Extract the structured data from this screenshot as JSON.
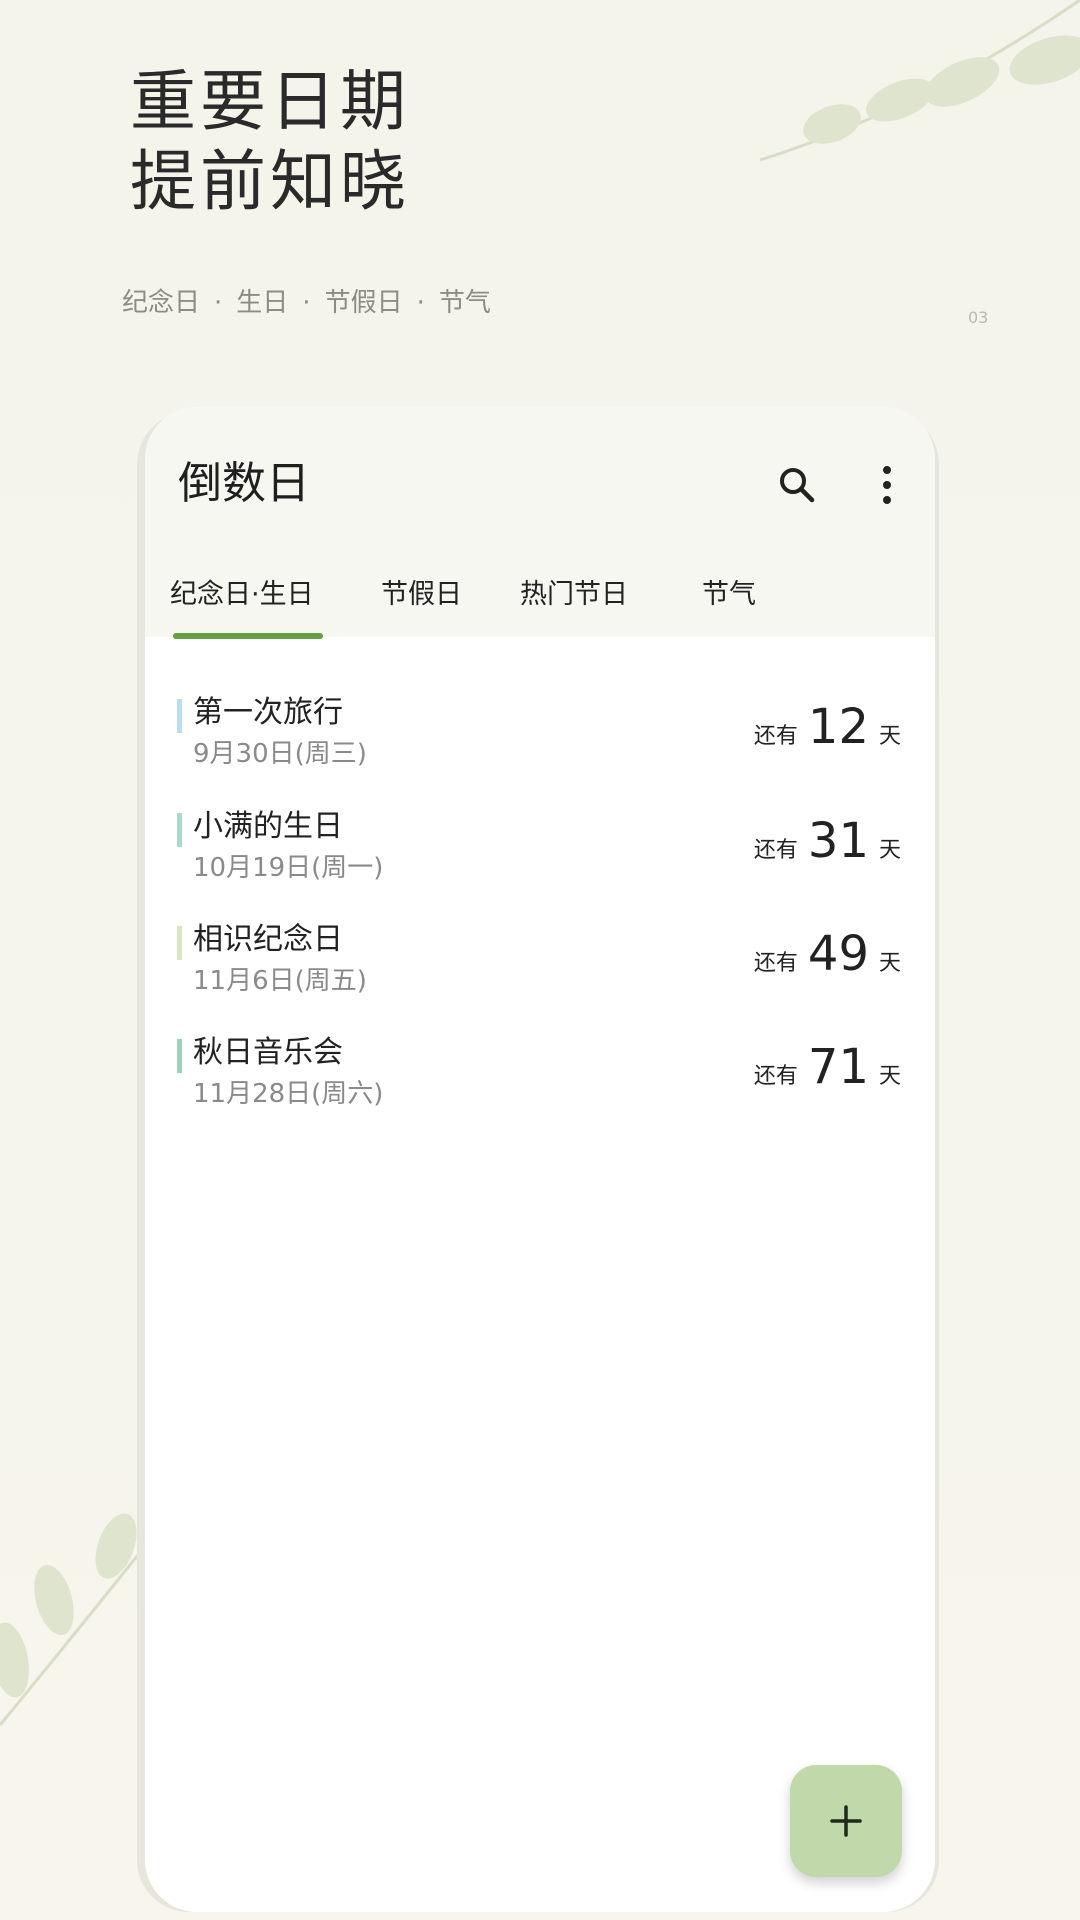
{
  "promo": {
    "title_line1": "重要日期",
    "title_line2": "提前知晓",
    "subtitle_items": [
      "纪念日",
      "生日",
      "节假日",
      "节气"
    ],
    "subtitle_separator": "·",
    "page_number": "03"
  },
  "app": {
    "title": "倒数日",
    "icons": {
      "search": "search-icon",
      "more": "more-vertical-icon",
      "add": "plus-icon"
    },
    "tabs": [
      {
        "label": "纪念日·生日",
        "selected": true
      },
      {
        "label": "节假日",
        "selected": false
      },
      {
        "label": "热门节日",
        "selected": false
      },
      {
        "label": "节气",
        "selected": false
      }
    ],
    "events": [
      {
        "name": "第一次旅行",
        "date": "9月30日(周三)",
        "prefix": "还有",
        "days": "12",
        "suffix": "天",
        "color": "#b9dcf2"
      },
      {
        "name": "小满的生日",
        "date": "10月19日(周一)",
        "prefix": "还有",
        "days": "31",
        "suffix": "天",
        "color": "#a9dcc8"
      },
      {
        "name": "相识纪念日",
        "date": "11月6日(周五)",
        "prefix": "还有",
        "days": "49",
        "suffix": "天",
        "color": "#d7e7c3"
      },
      {
        "name": "秋日音乐会",
        "date": "11月28日(周六)",
        "prefix": "还有",
        "days": "71",
        "suffix": "天",
        "color": "#9fd3b8"
      }
    ]
  },
  "colors": {
    "accent": "#64a043",
    "fab": "#c1d9aa",
    "background": "#f5f5ec",
    "leaf": "#d9e0c6"
  }
}
